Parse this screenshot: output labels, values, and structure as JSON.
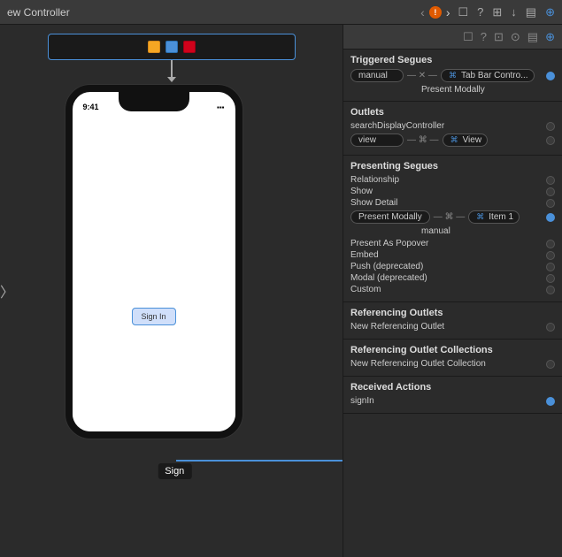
{
  "topbar": {
    "title": "ew Controller",
    "warning": "!",
    "icons": [
      "◁",
      "▷",
      "⊡",
      "?",
      "⊞",
      "⊙",
      "⊟",
      "⊕"
    ]
  },
  "canvas": {
    "component_dots": [
      "yellow",
      "blue",
      "red"
    ],
    "phone_status_time": "9:41",
    "sign_in_button_label": "Sign In",
    "sign_tooltip": "Sign",
    "left_nav_arrow": "〉"
  },
  "inspector": {
    "triggered_segues_title": "Triggered Segues",
    "triggered_manual_label": "manual",
    "triggered_tab_bar_label": "Tab Bar Contro...",
    "triggered_present_modally_sub": "Present Modally",
    "outlets_title": "Outlets",
    "outlets_search_label": "searchDisplayController",
    "outlets_view_badge": "view",
    "outlets_view_target": "View",
    "presenting_segues_title": "Presenting Segues",
    "relationship_label": "Relationship",
    "show_label": "Show",
    "show_detail_label": "Show Detail",
    "present_modally_badge": "Present Modally",
    "present_modally_item": "Item 1",
    "present_modally_sub": "manual",
    "present_as_popover_label": "Present As Popover",
    "embed_label": "Embed",
    "push_deprecated_label": "Push (deprecated)",
    "modal_deprecated_label": "Modal (deprecated)",
    "custom_label": "Custom",
    "referencing_outlets_title": "Referencing Outlets",
    "new_referencing_outlet_label": "New Referencing Outlet",
    "referencing_outlet_collections_title": "Referencing Outlet Collections",
    "new_referencing_outlet_collection_label": "New Referencing Outlet Collection",
    "received_actions_title": "Received Actions",
    "sign_in_action_label": "signIn"
  }
}
